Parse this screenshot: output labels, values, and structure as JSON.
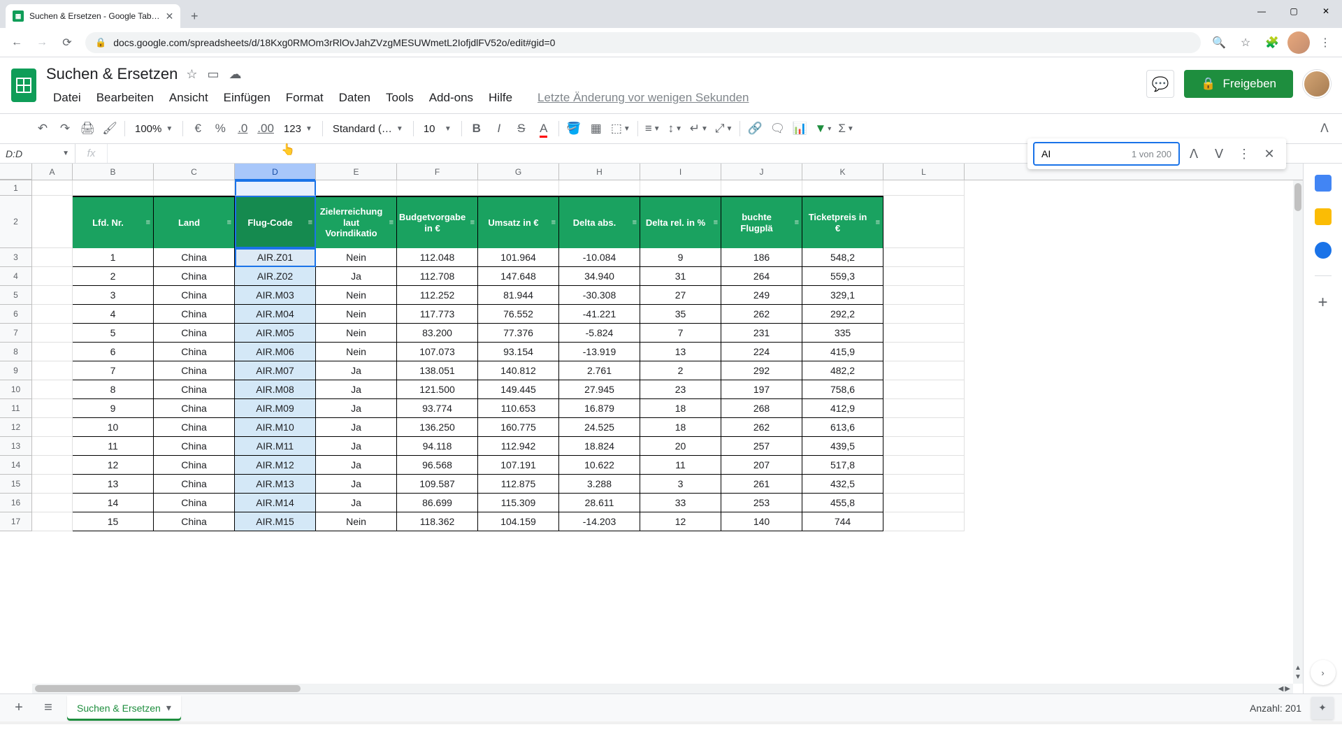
{
  "browser": {
    "tab_title": "Suchen & Ersetzen - Google Tab…",
    "url": "docs.google.com/spreadsheets/d/18Kxg0RMOm3rRlOvJahZVzgMESUWmetL2IofjdlFV52o/edit#gid=0"
  },
  "doc": {
    "title": "Suchen & Ersetzen",
    "last_edit": "Letzte Änderung vor wenigen Sekunden",
    "share_label": "Freigeben"
  },
  "menu": {
    "datei": "Datei",
    "bearbeiten": "Bearbeiten",
    "ansicht": "Ansicht",
    "einfuegen": "Einfügen",
    "format": "Format",
    "daten": "Daten",
    "tools": "Tools",
    "addons": "Add-ons",
    "hilfe": "Hilfe"
  },
  "toolbar": {
    "zoom": "100%",
    "font": "Standard (…",
    "fontsize": "10",
    "currency": "€",
    "percent": "%",
    "dec_minus": ".0",
    "dec_plus": ".00",
    "numfmt": "123"
  },
  "namebox": "D:D",
  "find": {
    "value": "AI",
    "count": "1 von 200"
  },
  "col_letters": [
    "A",
    "B",
    "C",
    "D",
    "E",
    "F",
    "G",
    "H",
    "I",
    "J",
    "K",
    "L"
  ],
  "headers": {
    "b": "Lfd. Nr.",
    "c": "Land",
    "d": "Flug-Code",
    "e": "Zielerreichung laut Vorindikatio",
    "f": "Budgetvorgabe in €",
    "g": "Umsatz in €",
    "h": "Delta abs.",
    "i": "Delta rel. in %",
    "j": "buchte Flugplä",
    "k": "Ticketpreis in €"
  },
  "chart_data": {
    "type": "table",
    "columns": [
      "Lfd. Nr.",
      "Land",
      "Flug-Code",
      "Zielerreichung laut Vorindikation",
      "Budgetvorgabe in €",
      "Umsatz in €",
      "Delta abs.",
      "Delta rel. in %",
      "gebuchte Flugplätze",
      "Ticketpreis in €"
    ],
    "rows": [
      [
        1,
        "China",
        "AIR.Z01",
        "Nein",
        "112.048",
        "101.964",
        "-10.084",
        9,
        186,
        "548,2"
      ],
      [
        2,
        "China",
        "AIR.Z02",
        "Ja",
        "112.708",
        "147.648",
        "34.940",
        31,
        264,
        "559,3"
      ],
      [
        3,
        "China",
        "AIR.M03",
        "Nein",
        "112.252",
        "81.944",
        "-30.308",
        27,
        249,
        "329,1"
      ],
      [
        4,
        "China",
        "AIR.M04",
        "Nein",
        "117.773",
        "76.552",
        "-41.221",
        35,
        262,
        "292,2"
      ],
      [
        5,
        "China",
        "AIR.M05",
        "Nein",
        "83.200",
        "77.376",
        "-5.824",
        7,
        231,
        "335"
      ],
      [
        6,
        "China",
        "AIR.M06",
        "Nein",
        "107.073",
        "93.154",
        "-13.919",
        13,
        224,
        "415,9"
      ],
      [
        7,
        "China",
        "AIR.M07",
        "Ja",
        "138.051",
        "140.812",
        "2.761",
        2,
        292,
        "482,2"
      ],
      [
        8,
        "China",
        "AIR.M08",
        "Ja",
        "121.500",
        "149.445",
        "27.945",
        23,
        197,
        "758,6"
      ],
      [
        9,
        "China",
        "AIR.M09",
        "Ja",
        "93.774",
        "110.653",
        "16.879",
        18,
        268,
        "412,9"
      ],
      [
        10,
        "China",
        "AIR.M10",
        "Ja",
        "136.250",
        "160.775",
        "24.525",
        18,
        262,
        "613,6"
      ],
      [
        11,
        "China",
        "AIR.M11",
        "Ja",
        "94.118",
        "112.942",
        "18.824",
        20,
        257,
        "439,5"
      ],
      [
        12,
        "China",
        "AIR.M12",
        "Ja",
        "96.568",
        "107.191",
        "10.622",
        11,
        207,
        "517,8"
      ],
      [
        13,
        "China",
        "AIR.M13",
        "Ja",
        "109.587",
        "112.875",
        "3.288",
        3,
        261,
        "432,5"
      ],
      [
        14,
        "China",
        "AIR.M14",
        "Ja",
        "86.699",
        "115.309",
        "28.611",
        33,
        253,
        "455,8"
      ],
      [
        15,
        "China",
        "AIR.M15",
        "Nein",
        "118.362",
        "104.159",
        "-14.203",
        12,
        140,
        "744"
      ]
    ]
  },
  "sheet_tab": "Suchen & Ersetzen",
  "status": {
    "count": "Anzahl: 201"
  },
  "colors": {
    "accent_green": "#1aa260",
    "share_green": "#1e8e3e",
    "selection_blue": "#1a73e8"
  }
}
